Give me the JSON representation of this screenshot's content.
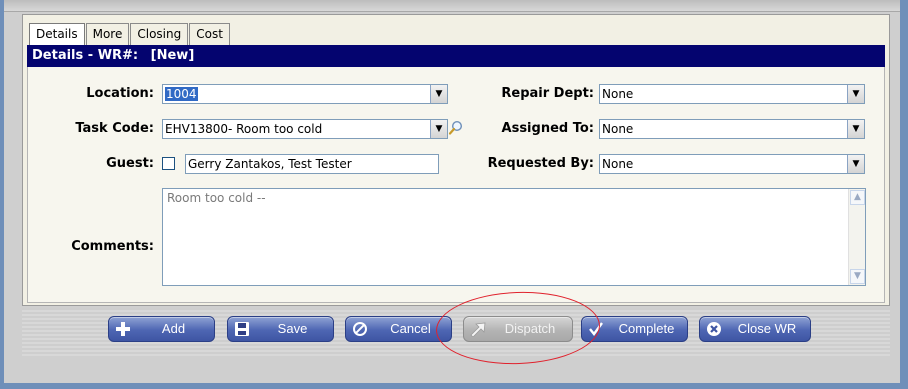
{
  "tabs": [
    {
      "label": "Details",
      "active": true
    },
    {
      "label": "More",
      "active": false
    },
    {
      "label": "Closing",
      "active": false
    },
    {
      "label": "Cost",
      "active": false
    }
  ],
  "header": {
    "title": "Details - WR#:",
    "wr_number": "[New]"
  },
  "form": {
    "location": {
      "label": "Location:",
      "value": "1004"
    },
    "task_code": {
      "label": "Task Code:",
      "value": "EHV13800- Room too cold"
    },
    "guest": {
      "label": "Guest:",
      "value": "Gerry Zantakos, Test Tester",
      "checked": false
    },
    "repair_dept": {
      "label": "Repair Dept:",
      "value": "None"
    },
    "assigned_to": {
      "label": "Assigned To:",
      "value": "None"
    },
    "requested_by": {
      "label": "Requested By:",
      "value": "None"
    },
    "comments": {
      "label": "Comments:",
      "value": "Room too cold --"
    }
  },
  "buttons": {
    "add": "Add",
    "save": "Save",
    "cancel": "Cancel",
    "dispatch": "Dispatch",
    "complete": "Complete",
    "close_wr": "Close WR"
  },
  "colors": {
    "title_bar": "#04046f",
    "button_blue": "#4e66b3",
    "highlight_circle": "#e0222d",
    "selection": "#316ac5"
  },
  "icons": {
    "add": "plus-icon",
    "save": "floppy-disk-icon",
    "cancel": "no-entry-icon",
    "dispatch": "arrow-icon",
    "complete": "checkmark-icon",
    "close_wr": "x-circle-icon",
    "task_lookup": "magnifier-icon"
  }
}
